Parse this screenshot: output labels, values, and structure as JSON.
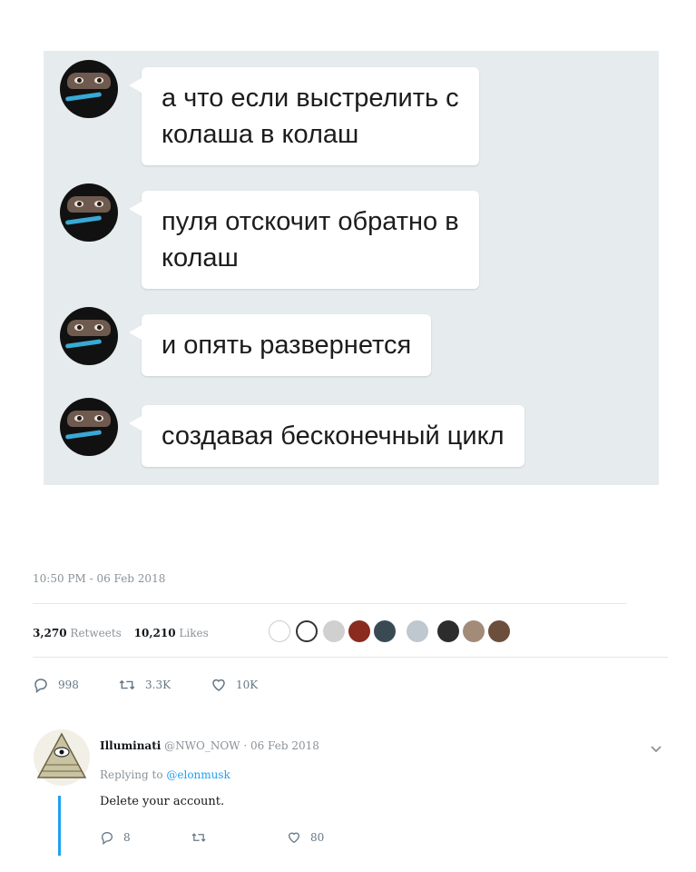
{
  "messages": [
    {
      "lines": [
        "а что если выстрелить с",
        "колаша в колаш"
      ]
    },
    {
      "lines": [
        "пуля отскочит обратно в",
        "колаш"
      ]
    },
    {
      "lines": [
        "и опять развернется"
      ]
    },
    {
      "lines": [
        "создавая бесконечный цикл"
      ]
    }
  ],
  "tweet": {
    "timestamp": "10:50 PM - 06 Feb 2018",
    "retweets_count": "3,270",
    "retweets_label": "Retweets",
    "likes_count": "10,210",
    "likes_label": "Likes",
    "actions": {
      "replies": "998",
      "retweets": "3.3K",
      "likes": "10K"
    }
  },
  "reply": {
    "name": "Illuminati",
    "handle": "@NWO_NOW",
    "date": "06 Feb 2018",
    "separator": "·",
    "replying_prefix": "Replying to",
    "replying_to": "@elonmusk",
    "text": "Delete your account.",
    "actions": {
      "replies": "8",
      "retweets": "",
      "likes": "80"
    }
  },
  "colors": {
    "chat_bg": "#e6ebee",
    "bubble_bg": "#ffffff",
    "link": "#1da1f2",
    "thread_line": "#1da1f2"
  }
}
